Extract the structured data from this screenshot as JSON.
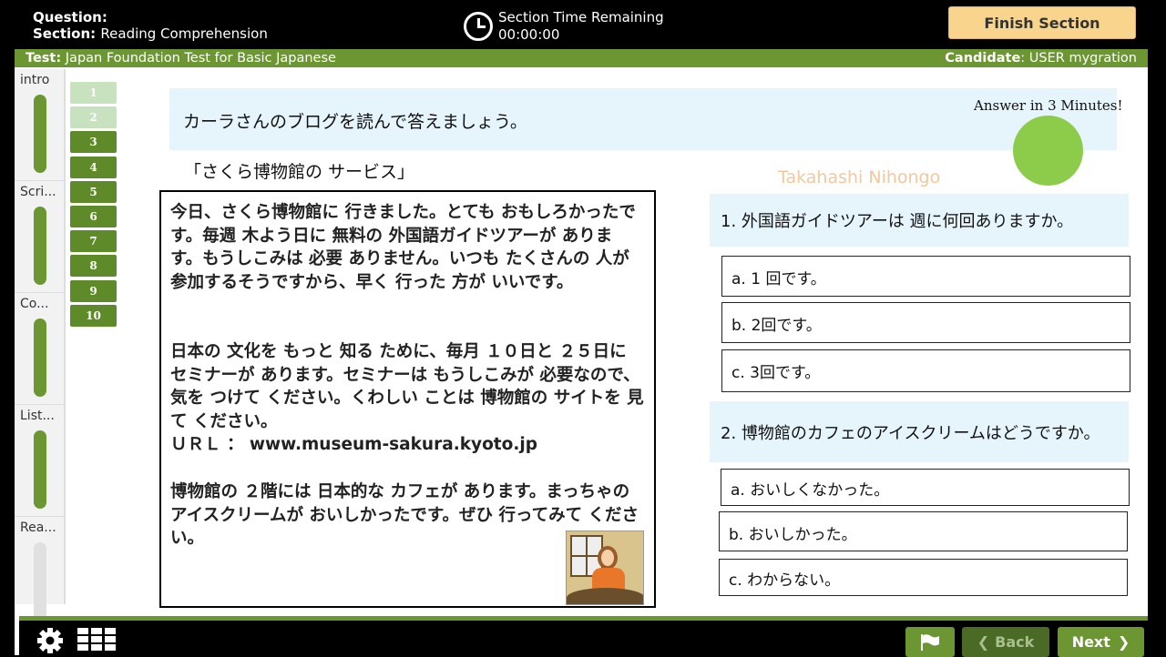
{
  "header": {
    "question_label": "Question:",
    "section_label": "Section:",
    "section_value": "Reading Comprehension",
    "timer_label": "Section Time Remaining",
    "timer_value": "00:00:00",
    "finish_label": "Finish Section"
  },
  "subheader": {
    "test_label": "Test:",
    "test_value": "Japan Foundation Test for Basic Japanese",
    "candidate_label": "Candidate",
    "candidate_value": ": USER mygration"
  },
  "sidebar": {
    "sections": [
      {
        "label": "intro"
      },
      {
        "label": "Scri..."
      },
      {
        "label": "Co..."
      },
      {
        "label": "List..."
      },
      {
        "label": "Rea..."
      }
    ]
  },
  "question_numbers": [
    "1",
    "2",
    "3",
    "4",
    "5",
    "6",
    "7",
    "8",
    "9",
    "10"
  ],
  "instruction": "カーラさんのブログを読んで答えましょう。",
  "answer_in": "Answer in 3 Minutes!",
  "watermark": "Takahashi Nihongo",
  "passage": {
    "title": "「さくら博物館の サービス」",
    "p1": "今日、さくら博物館に 行きました。とても おもしろかったです。毎週 木よう日に 無料の 外国語ガイドツアーが あります。もうしこみは 必要 ありません。いつも たくさんの 人が 参加するそうですから、早く 行った 方が いいです。",
    "p2": "日本の 文化を もっと 知る ために、毎月 １０日と ２５日に セミナーが あります。セミナーは もうしこみが 必要なので、気を つけて ください。くわしい ことは 博物館の サイトを 見て ください。",
    "url": "ＵＲＬ ： www.museum-sakura.kyoto.jp",
    "p3": "博物館の ２階には 日本的な カフェが あります。まっちゃの アイスクリームが おいしかったです。ぜひ 行ってみて ください。"
  },
  "questions": [
    {
      "text": "1. 外国語ガイドツアーは 週に何回ありますか。",
      "options": [
        "a. 1 回です。",
        "b.  2回です。",
        "c.  3回です。"
      ]
    },
    {
      "text": "2. 博物館のカフェのアイスクリームはどうですか。",
      "options": [
        "a. おいしくなかった。",
        "b. おいしかった。",
        "c. わからない。"
      ]
    }
  ],
  "footer": {
    "back_label": "Back",
    "next_label": "Next"
  }
}
